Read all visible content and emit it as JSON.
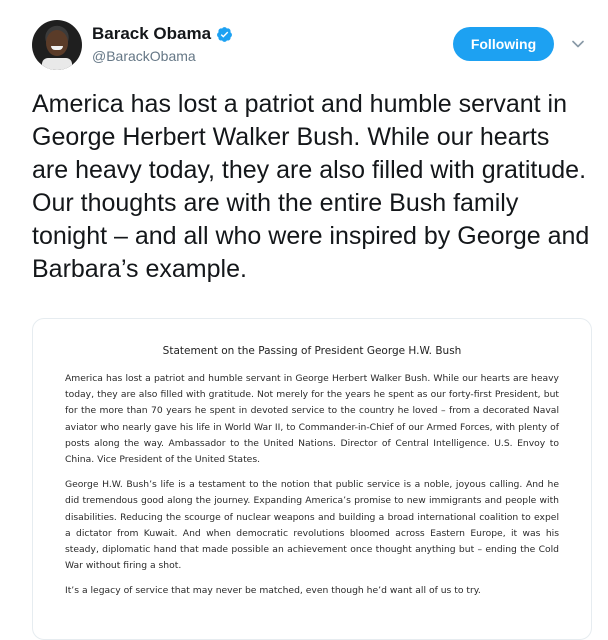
{
  "user": {
    "name": "Barack Obama",
    "handle": "@BarackObama",
    "verified": true
  },
  "follow_button": {
    "label": "Following"
  },
  "tweet": {
    "text": "America has lost a patriot and humble servant in George Herbert Walker Bush. While our hearts are heavy today, they are also filled with gratitude. Our thoughts are with the entire Bush family tonight – and all who were inspired by George and Barbara’s example."
  },
  "statement": {
    "title": "Statement on the Passing of President George H.W. Bush",
    "paragraphs": [
      "America has lost a patriot and humble servant in George Herbert Walker Bush. While our hearts are heavy today, they are also filled with gratitude. Not merely for the years he spent as our forty-first President, but for the more than 70 years he spent in devoted service to the country he loved – from a decorated Naval aviator who nearly gave his life in World War II, to Commander-in-Chief of our Armed Forces, with plenty of posts along the way. Ambassador to the United Nations. Director of Central Intelligence. U.S. Envoy to China. Vice President of the United States.",
      "George H.W. Bush’s life is a testament to the notion that public service is a noble, joyous calling. And he did tremendous good along the journey. Expanding America’s promise to new immigrants and people with disabilities. Reducing the scourge of nuclear weapons and building a broad international coalition to expel a dictator from Kuwait. And when democratic revolutions bloomed across Eastern Europe, it was his steady, diplomatic hand that made possible an achievement once thought anything but – ending the Cold War without firing a shot.",
      "It’s a legacy of service that may never be matched, even though he’d want all of us to try."
    ]
  },
  "colors": {
    "accent": "#1da1f2",
    "text_primary": "#14171a",
    "text_secondary": "#657786"
  },
  "icons": {
    "verified": "verified-badge-icon",
    "menu": "chevron-down-icon"
  }
}
